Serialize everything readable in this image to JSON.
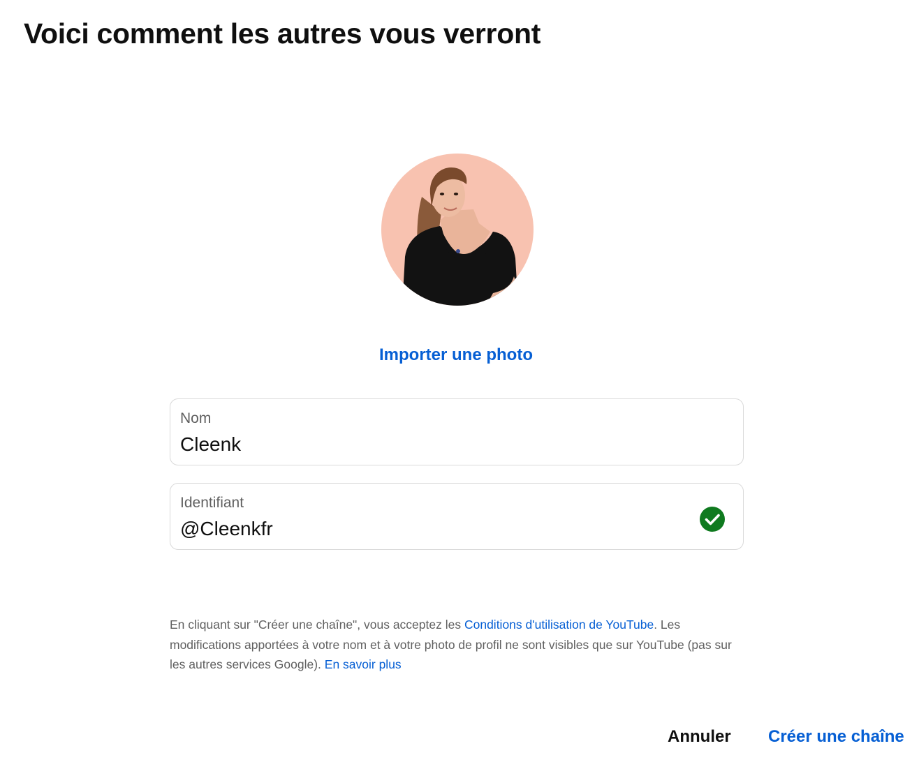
{
  "dialog": {
    "title": "Voici comment les autres vous verront"
  },
  "avatar": {
    "background_color": "#f8c2b0",
    "icon": "profile-photo"
  },
  "upload_photo_label": "Importer une photo",
  "fields": {
    "name": {
      "label": "Nom",
      "value": "Cleenk"
    },
    "handle": {
      "label": "Identifiant",
      "value": "@Cleenkfr",
      "status_icon": "check-circle-icon",
      "status_color": "#0f7a1f"
    }
  },
  "legal": {
    "text_1": "En cliquant sur \"Créer une chaîne\", vous acceptez les ",
    "terms_link": "Conditions d'utilisation de YouTube",
    "text_2": ". Les modifications apportées à votre nom et à votre photo de profil ne sont visibles que sur YouTube (pas sur les autres services Google). ",
    "learn_more_link": "En savoir plus"
  },
  "actions": {
    "cancel_label": "Annuler",
    "create_label": "Créer une chaîne"
  },
  "colors": {
    "accent": "#065fd4",
    "text_primary": "#0f0f0f",
    "text_secondary": "#606060"
  }
}
